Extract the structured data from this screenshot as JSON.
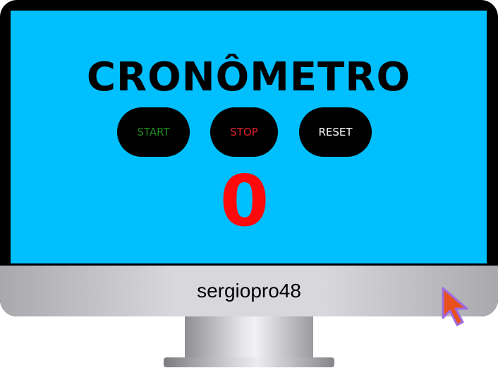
{
  "screen": {
    "title": "CRONÔMETRO",
    "buttons": {
      "start_label": "START",
      "stop_label": "STOP",
      "reset_label": "RESET"
    },
    "counter_value": "0"
  },
  "monitor": {
    "chin_label": "sergiopro48"
  },
  "colors": {
    "screen_bg": "#00bfff",
    "start_text": "#1f8a1f",
    "stop_text": "#e0202a",
    "reset_text": "#ffffff",
    "counter": "#ff0a0a",
    "cursor_fill": "#e8501e",
    "cursor_outline": "#a06be0"
  },
  "icons": {
    "cursor": "mouse-pointer-icon"
  }
}
